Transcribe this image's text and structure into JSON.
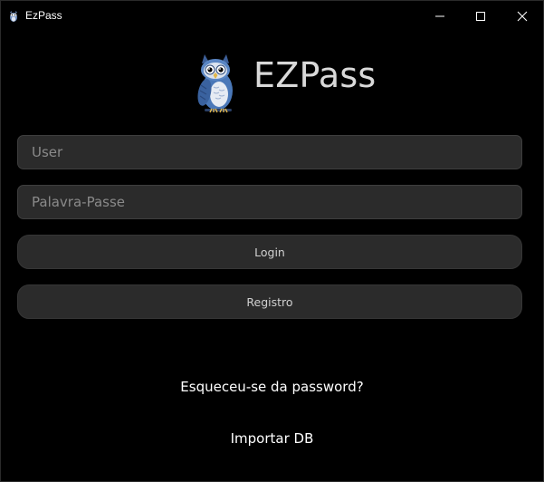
{
  "window": {
    "title": "EzPass",
    "icons": {
      "app": "owl-icon",
      "minimize": "minimize-icon",
      "maximize": "maximize-icon",
      "close": "close-icon"
    }
  },
  "header": {
    "logo": "owl-logo",
    "title": "EZPass"
  },
  "form": {
    "user": {
      "placeholder": "User",
      "value": ""
    },
    "password": {
      "placeholder": "Palavra-Passe",
      "value": ""
    },
    "login_label": "Login",
    "register_label": "Registro"
  },
  "links": {
    "forgot_password": "Esqueceu-se da password?",
    "import_db": "Importar DB"
  },
  "colors": {
    "background": "#000000",
    "field_background": "#2b2b2b",
    "title_text": "#d9d9d9",
    "owl_blue": "#4a78b8"
  }
}
